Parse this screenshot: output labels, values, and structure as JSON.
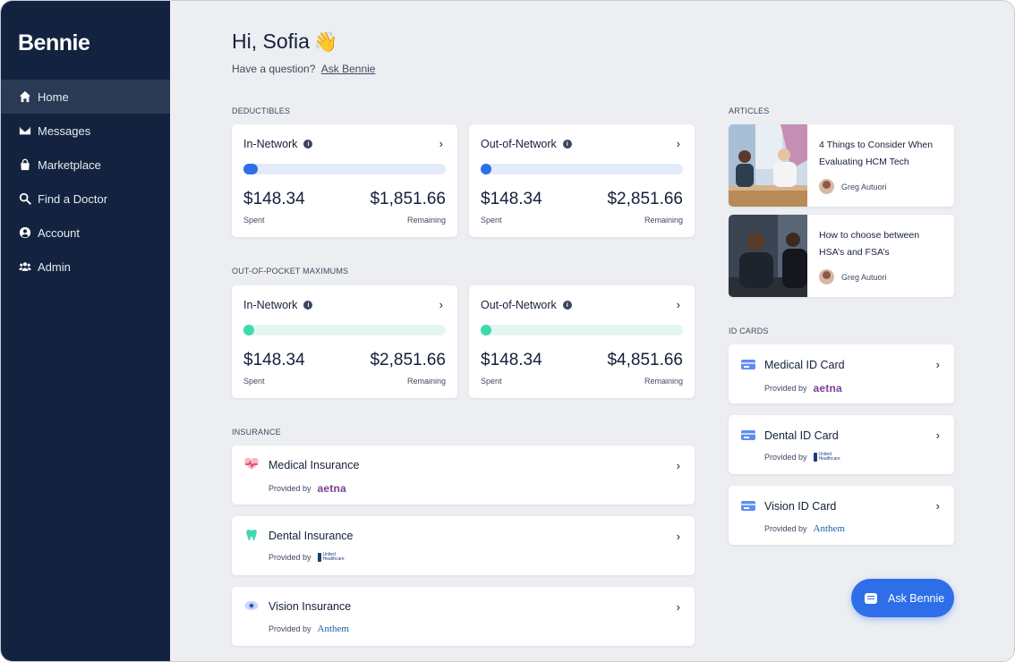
{
  "brand": {
    "logo": "Bennie"
  },
  "sidebar": {
    "items": [
      {
        "label": "Home",
        "icon": "home-icon",
        "active": true
      },
      {
        "label": "Messages",
        "icon": "envelope-icon"
      },
      {
        "label": "Marketplace",
        "icon": "shopping-bag-icon"
      },
      {
        "label": "Find a Doctor",
        "icon": "search-icon"
      },
      {
        "label": "Account",
        "icon": "user-circle-icon"
      },
      {
        "label": "Admin",
        "icon": "users-icon"
      }
    ]
  },
  "header": {
    "greeting": "Hi, Sofia",
    "wave": "👋",
    "question": "Have a question?",
    "ask_link": "Ask Bennie"
  },
  "deductibles": {
    "label": "DEDUCTIBLES",
    "cards": [
      {
        "title": "In-Network",
        "spent": "$148.34",
        "remaining": "$1,851.66",
        "spent_label": "Spent",
        "remaining_label": "Remaining",
        "progress": 0.07
      },
      {
        "title": "Out-of-Network",
        "spent": "$148.34",
        "remaining": "$2,851.66",
        "spent_label": "Spent",
        "remaining_label": "Remaining",
        "progress": 0.05
      }
    ]
  },
  "oop": {
    "label": "OUT-OF-POCKET MAXIMUMS",
    "cards": [
      {
        "title": "In-Network",
        "spent": "$148.34",
        "remaining": "$2,851.66",
        "spent_label": "Spent",
        "remaining_label": "Remaining",
        "progress": 0.05
      },
      {
        "title": "Out-of-Network",
        "spent": "$148.34",
        "remaining": "$4,851.66",
        "spent_label": "Spent",
        "remaining_label": "Remaining",
        "progress": 0.03
      }
    ]
  },
  "insurance": {
    "label": "INSURANCE",
    "items": [
      {
        "title": "Medical Insurance",
        "provided_by": "Provided by",
        "provider": "aetna",
        "icon": "heartbeat-icon"
      },
      {
        "title": "Dental Insurance",
        "provided_by": "Provided by",
        "provider": "United Healthcare",
        "icon": "tooth-icon"
      },
      {
        "title": "Vision Insurance",
        "provided_by": "Provided by",
        "provider": "Anthem",
        "icon": "eye-icon"
      }
    ]
  },
  "articles": {
    "label": "ARTICLES",
    "items": [
      {
        "title": "4 Things to Consider When Evaluating HCM Tech",
        "author": "Greg Autuori"
      },
      {
        "title": "How to choose between HSA’s and FSA’s",
        "author": "Greg Autuori"
      }
    ]
  },
  "id_cards": {
    "label": "ID CARDS",
    "items": [
      {
        "title": "Medical ID Card",
        "provided_by": "Provided by",
        "provider": "aetna"
      },
      {
        "title": "Dental ID Card",
        "provided_by": "Provided by",
        "provider": "United Healthcare"
      },
      {
        "title": "Vision ID Card",
        "provided_by": "Provided by",
        "provider": "Anthem"
      }
    ]
  },
  "ask_button": {
    "label": "Ask Bennie"
  },
  "chevron": "›",
  "info_glyph": "i",
  "colors": {
    "sidebar_bg": "#13233f",
    "accent_blue": "#2e6ee9",
    "accent_green": "#3ed9ae",
    "aetna": "#7d3f98",
    "anthem": "#1a5fa8"
  }
}
